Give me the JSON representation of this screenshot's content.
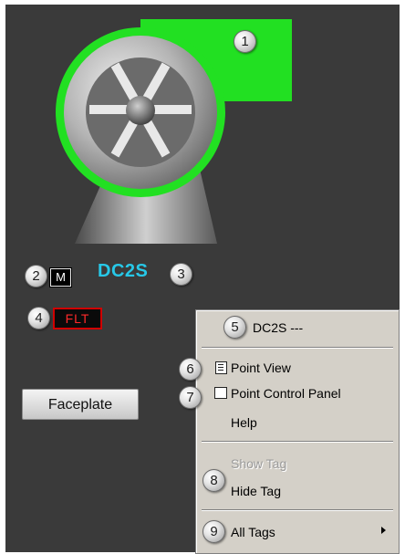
{
  "tag": {
    "name": "DC2S",
    "mode": "M",
    "fault": "FLT",
    "name_color": "#27c8e8"
  },
  "fan": {
    "housing_color": "#22e022",
    "status": "running"
  },
  "faceplate": {
    "label": "Faceplate"
  },
  "context_menu": {
    "header": "DC2S ---",
    "items": [
      {
        "label": "Point View",
        "icon": "point-view-icon",
        "enabled": true
      },
      {
        "label": "Point Control Panel",
        "icon": "point-control-panel-icon",
        "enabled": true
      },
      {
        "label": "Help",
        "enabled": true
      },
      {
        "label": "Show Tag",
        "enabled": false
      },
      {
        "label": "Hide Tag",
        "enabled": true
      },
      {
        "label": "All Tags",
        "enabled": true,
        "submenu": true
      }
    ]
  },
  "callouts": [
    "1",
    "2",
    "3",
    "4",
    "5",
    "6",
    "7",
    "8",
    "9"
  ]
}
